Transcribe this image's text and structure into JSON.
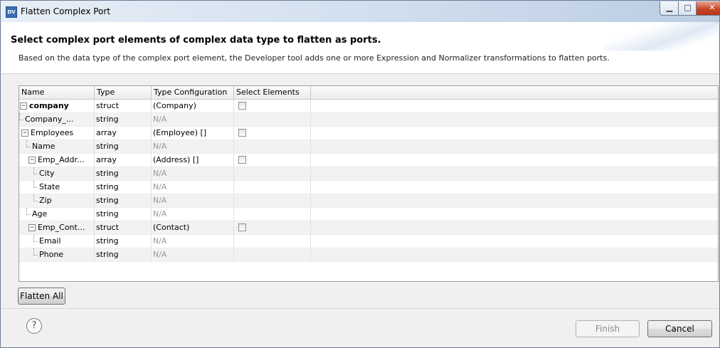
{
  "window": {
    "title": "Flatten Complex Port",
    "app_icon": "DV"
  },
  "header": {
    "title": "Select complex port elements of complex data type to flatten as ports.",
    "description": "Based on the data type of the complex port element, the Developer tool adds one or more Expression and Normalizer transformations to flatten ports."
  },
  "table": {
    "columns": [
      "Name",
      "Type",
      "Type Configuration",
      "Select Elements"
    ],
    "rows": [
      {
        "name": "company",
        "type": "struct",
        "config": "(Company)",
        "checkbox": true
      },
      {
        "name": "Company_...",
        "type": "string",
        "config": "N/A",
        "checkbox": false
      },
      {
        "name": "Employees",
        "type": "array",
        "config": "(Employee) []",
        "checkbox": true
      },
      {
        "name": "Name",
        "type": "string",
        "config": "N/A",
        "checkbox": false
      },
      {
        "name": "Emp_Addr...",
        "type": "array",
        "config": "(Address) []",
        "checkbox": true
      },
      {
        "name": "City",
        "type": "string",
        "config": "N/A",
        "checkbox": false
      },
      {
        "name": "State",
        "type": "string",
        "config": "N/A",
        "checkbox": false
      },
      {
        "name": "Zip",
        "type": "string",
        "config": "N/A",
        "checkbox": false
      },
      {
        "name": "Age",
        "type": "string",
        "config": "N/A",
        "checkbox": false
      },
      {
        "name": "Emp_Cont...",
        "type": "struct",
        "config": "(Contact)",
        "checkbox": true
      },
      {
        "name": "Email",
        "type": "string",
        "config": "N/A",
        "checkbox": false
      },
      {
        "name": "Phone",
        "type": "string",
        "config": "N/A",
        "checkbox": false
      }
    ]
  },
  "buttons": {
    "flatten_all": "Flatten All",
    "finish": "Finish",
    "cancel": "Cancel",
    "help": "?"
  }
}
